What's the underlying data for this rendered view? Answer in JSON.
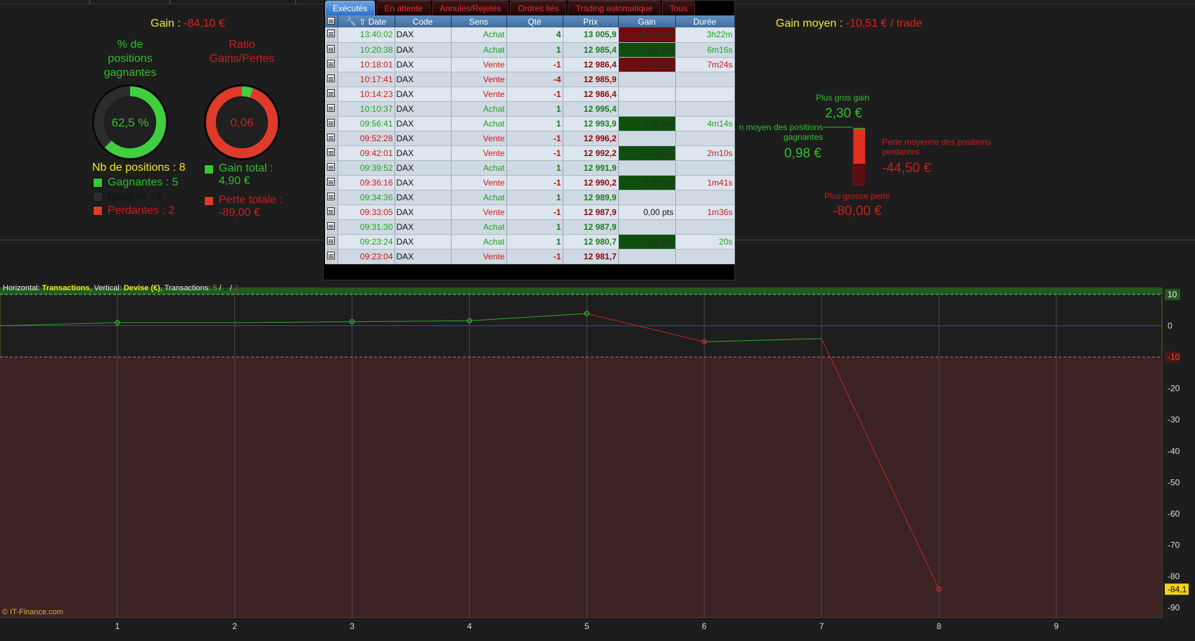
{
  "stats": {
    "gain_label": "Gain :",
    "gain_value": "-84,10 €",
    "pct_win_label_l1": "% de",
    "pct_win_label_l2": "positions",
    "pct_win_label_l3": "gagnantes",
    "pct_win_value": "62,5 %",
    "pct_win_fraction": 0.625,
    "ratio_label_l1": "Ratio",
    "ratio_label_l2": "Gains/Pertes",
    "ratio_value": "0,06",
    "ratio_fraction": 0.05,
    "nb_positions": "Nb de positions : 8",
    "gagnantes": "Gagnantes : 5",
    "neutres": "Neutres : 1",
    "perdantes": "Perdantes : 2",
    "gain_total_l1": "Gain total :",
    "gain_total_l2": "4,90 €",
    "perte_totale_l1": "Perte totale :",
    "perte_totale_l2": "-89,00 €",
    "gain_moyen_label": "Gain moyen :",
    "gain_moyen_value": "-10,51 € / trade",
    "plus_gros_gain_label": "Plus gros gain",
    "plus_gros_gain_value": "2,30 €",
    "gain_moyen_pos_label_l1": "n moyen des positions",
    "gain_moyen_pos_label_l2": "gagnantes",
    "gain_moyen_pos_value": "0,98 €",
    "perte_moyenne_label_l1": "Perte moyenne des positions",
    "perte_moyenne_label_l2": "perdantes",
    "perte_moyenne_value": "-44,50 €",
    "plus_grosse_perte_label": "Plus grosse perte",
    "plus_grosse_perte_value": "-80,00 €"
  },
  "colors": {
    "green": "#2fbf2f",
    "red": "#c81e1e",
    "yellow": "#f2e82b",
    "tab_active": "#2e6fc2"
  },
  "orders": {
    "tabs": [
      "Exécutés",
      "En attente",
      "Annulés/Rejetés",
      "Ordres liés",
      "Trading automatique",
      "Tous"
    ],
    "columns": [
      "Date",
      "Code",
      "Sens",
      "Qté",
      "Prix",
      "Gain",
      "Durée"
    ],
    "rows": [
      {
        "time": "13:40:02",
        "code": "DAX",
        "sens": "Achat",
        "qte": "4",
        "prix": "13 005,9",
        "gain": "-80,00 pts",
        "duree": "3h22m"
      },
      {
        "time": "10:20:38",
        "code": "DAX",
        "sens": "Achat",
        "qte": "1",
        "prix": "12 985,4",
        "gain": "1,00 pts",
        "duree": "6m16s"
      },
      {
        "time": "10:18:01",
        "code": "DAX",
        "sens": "Vente",
        "qte": "-1",
        "prix": "12 986,4",
        "gain": "-9,00 pts",
        "duree": "7m24s"
      },
      {
        "time": "10:17:41",
        "code": "DAX",
        "sens": "Vente",
        "qte": "-4",
        "prix": "12 985,9",
        "gain": "",
        "duree": ""
      },
      {
        "time": "10:14:23",
        "code": "DAX",
        "sens": "Vente",
        "qte": "-1",
        "prix": "12 986,4",
        "gain": "",
        "duree": ""
      },
      {
        "time": "10:10:37",
        "code": "DAX",
        "sens": "Achat",
        "qte": "1",
        "prix": "12 995,4",
        "gain": "",
        "duree": ""
      },
      {
        "time": "09:56:41",
        "code": "DAX",
        "sens": "Achat",
        "qte": "1",
        "prix": "12 993,9",
        "gain": "2,30 pts",
        "duree": "4m14s"
      },
      {
        "time": "09:52:28",
        "code": "DAX",
        "sens": "Vente",
        "qte": "-1",
        "prix": "12 996,2",
        "gain": "",
        "duree": ""
      },
      {
        "time": "09:42:01",
        "code": "DAX",
        "sens": "Vente",
        "qte": "-1",
        "prix": "12 992,2",
        "gain": "0,30 pts",
        "duree": "2m10s"
      },
      {
        "time": "09:39:52",
        "code": "DAX",
        "sens": "Achat",
        "qte": "1",
        "prix": "12 991,9",
        "gain": "",
        "duree": ""
      },
      {
        "time": "09:36:16",
        "code": "DAX",
        "sens": "Vente",
        "qte": "-1",
        "prix": "12 990,2",
        "gain": "0,30 pts",
        "duree": "1m41s"
      },
      {
        "time": "09:34:36",
        "code": "DAX",
        "sens": "Achat",
        "qte": "1",
        "prix": "12 989,9",
        "gain": "",
        "duree": ""
      },
      {
        "time": "09:33:05",
        "code": "DAX",
        "sens": "Vente",
        "qte": "-1",
        "prix": "12 987,9",
        "gain": "0,00 pts",
        "duree": "1m36s"
      },
      {
        "time": "09:31:30",
        "code": "DAX",
        "sens": "Achat",
        "qte": "1",
        "prix": "12 987,9",
        "gain": "",
        "duree": ""
      },
      {
        "time": "09:23:24",
        "code": "DAX",
        "sens": "Achat",
        "qte": "1",
        "prix": "12 980,7",
        "gain": "1,00 pts",
        "duree": "20s"
      },
      {
        "time": "09:23:04",
        "code": "DAX",
        "sens": "Vente",
        "qte": "-1",
        "prix": "12 981,7",
        "gain": "",
        "duree": ""
      }
    ]
  },
  "chart_info": {
    "horizontal_label": "Horizontal:",
    "horizontal_value": "Transactions",
    "vertical_label": "Vertical:",
    "vertical_value": "Devise (€)",
    "transactions_label": "Transactions:",
    "transactions_counts": [
      "5",
      "1",
      "2"
    ]
  },
  "copyright": "© IT-Finance.com",
  "chart_data": {
    "type": "line",
    "title": "",
    "xlabel": "Transactions",
    "ylabel": "Devise (€)",
    "x": [
      0,
      1,
      2,
      3,
      4,
      5,
      6,
      7,
      8
    ],
    "y": [
      0,
      1,
      1,
      1.3,
      1.6,
      3.9,
      -5.1,
      -4.1,
      -84.1
    ],
    "markers_at": [
      1,
      3,
      4,
      5,
      6,
      8
    ],
    "xlim": [
      0,
      9.9
    ],
    "ylim": [
      -93,
      12
    ],
    "xticks": [
      "1",
      "2",
      "3",
      "4",
      "5",
      "6",
      "7",
      "8",
      "9"
    ],
    "yticks": [
      "10",
      "0",
      "-10",
      "-20",
      "-30",
      "-40",
      "-50",
      "-60",
      "-70",
      "-80",
      "-90"
    ],
    "upper_threshold": 10,
    "lower_threshold": -10,
    "last_value_label": "-84,1"
  }
}
